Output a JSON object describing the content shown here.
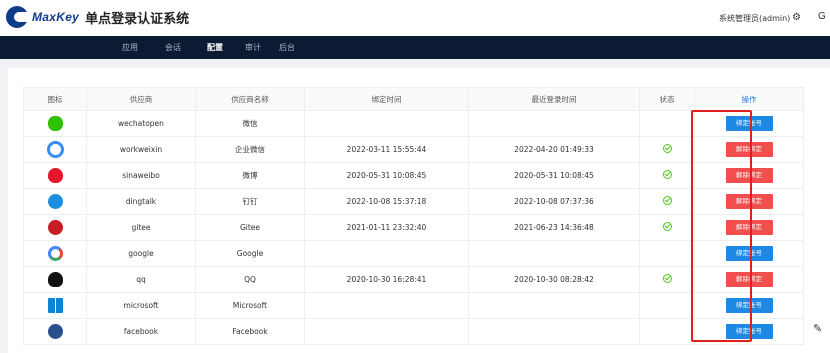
{
  "app": {
    "logo_text": "MaxKey",
    "title": "单点登录认证系统"
  },
  "header": {
    "user": "系统管理员(admin)",
    "right_letter": "G"
  },
  "nav": {
    "items": [
      "应用",
      "会话",
      "配置",
      "审计",
      "后台"
    ],
    "active": "配置"
  },
  "table": {
    "headers": [
      "图标",
      "供应商",
      "供应商名称",
      "绑定时间",
      "最近登录时间",
      "状态",
      "操作"
    ],
    "rows": [
      {
        "icon": "wechat-icon",
        "provider": "wechatopen",
        "name": "微信",
        "bind_time": "",
        "last_login": "",
        "status": false,
        "action": "绑定账号",
        "action_type": "bind"
      },
      {
        "icon": "wecom-icon",
        "provider": "workweixin",
        "name": "企业微信",
        "bind_time": "2022-03-11 15:55:44",
        "last_login": "2022-04-20 01:49:33",
        "status": true,
        "action": "解除绑定",
        "action_type": "unbind"
      },
      {
        "icon": "weibo-icon",
        "provider": "sinaweibo",
        "name": "微博",
        "bind_time": "2020-05-31 10:08:45",
        "last_login": "2020-05-31 10:08:45",
        "status": true,
        "action": "解除绑定",
        "action_type": "unbind"
      },
      {
        "icon": "dingtalk-icon",
        "provider": "dingtalk",
        "name": "钉钉",
        "bind_time": "2022-10-08 15:37:18",
        "last_login": "2022-10-08 07:37:36",
        "status": true,
        "action": "解除绑定",
        "action_type": "unbind"
      },
      {
        "icon": "gitee-icon",
        "provider": "gitee",
        "name": "Gitee",
        "bind_time": "2021-01-11 23:32:40",
        "last_login": "2021-06-23 14:36:48",
        "status": true,
        "action": "解除绑定",
        "action_type": "unbind"
      },
      {
        "icon": "google-icon",
        "provider": "google",
        "name": "Google",
        "bind_time": "",
        "last_login": "",
        "status": false,
        "action": "绑定账号",
        "action_type": "bind"
      },
      {
        "icon": "qq-icon",
        "provider": "qq",
        "name": "QQ",
        "bind_time": "2020-10-30 16:28:41",
        "last_login": "2020-10-30 08:28:42",
        "status": true,
        "action": "解除绑定",
        "action_type": "unbind"
      },
      {
        "icon": "windows-icon",
        "provider": "microsoft",
        "name": "Microsoft",
        "bind_time": "",
        "last_login": "",
        "status": false,
        "action": "绑定账号",
        "action_type": "bind"
      },
      {
        "icon": "facebook-icon",
        "provider": "facebook",
        "name": "Facebook",
        "bind_time": "",
        "last_login": "",
        "status": false,
        "action": "绑定账号",
        "action_type": "bind"
      }
    ]
  },
  "colors": {
    "bind": "#1e88e5",
    "unbind": "#f24e4e",
    "nav_bg": "#0b1b34",
    "highlight": "#e02020"
  }
}
